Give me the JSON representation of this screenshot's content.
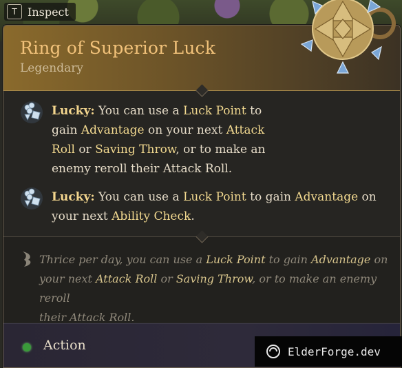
{
  "inspect": {
    "key": "T",
    "label": "Inspect"
  },
  "item": {
    "name": "Ring of Superior Luck",
    "rarity": "Legendary"
  },
  "passives": [
    {
      "label": "Lucky:",
      "parts": [
        " You can use a ",
        "Luck Point",
        " to",
        "gain ",
        "Advantage",
        " on your next ",
        "Attack",
        "Roll",
        " or ",
        "Saving Throw",
        ", or to make an",
        "enemy reroll their Attack Roll."
      ]
    },
    {
      "label": "Lucky:",
      "parts": [
        " You can use a ",
        "Luck Point",
        " to gain ",
        "Advantage",
        " on",
        "your next ",
        "Ability Check",
        "."
      ]
    }
  ],
  "description": {
    "parts": [
      "Thrice per day, you can use a ",
      "Luck Point",
      " to gain ",
      "Advantage",
      " on",
      "your next ",
      "Attack Roll",
      " or ",
      "Saving Throw",
      ", or to make an enemy reroll",
      "their Attack Roll."
    ]
  },
  "footer": {
    "action_label": "Action"
  },
  "watermark": {
    "text": "ElderForge.dev"
  },
  "colors": {
    "title": "#f2c27a",
    "highlight": "#f1d88f",
    "action_dot": "#3a9a3a"
  },
  "icons": {
    "passive": "lucky-clover-dice-icon",
    "description": "quill-icon",
    "item": "ring-gem-icon"
  }
}
